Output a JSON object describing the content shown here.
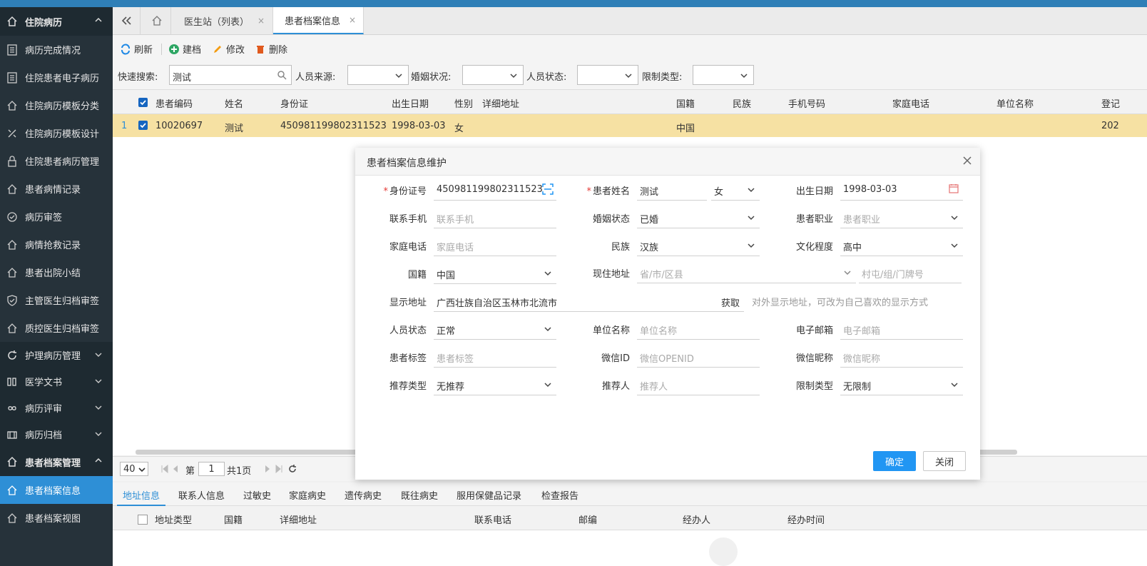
{
  "sidebar": {
    "group1": "住院病历",
    "items": [
      "病历完成情况",
      "住院患者电子病历",
      "住院病历模板分类",
      "住院病历模板设计",
      "住院患者病历管理",
      "患者病情记录",
      "病历审签",
      "病情抢救记录",
      "患者出院小结",
      "主管医生归档审签",
      "质控医生归档审签"
    ],
    "groups": [
      "护理病历管理",
      "医学文书",
      "病历评审",
      "病历归档"
    ],
    "group6": "患者档案管理",
    "sub_items": [
      "患者档案信息",
      "患者档案视图"
    ]
  },
  "tabs": {
    "tab1": "医生站（列表）",
    "tab2": "患者档案信息",
    "close": "×"
  },
  "toolbar": {
    "refresh": "刷新",
    "create": "建档",
    "edit": "修改",
    "delete": "删除"
  },
  "search": {
    "quick_label": "快速搜索:",
    "quick_value": "测试",
    "source_label": "人员来源:",
    "marital_label": "婚姻状况:",
    "status_label": "人员状态:",
    "limit_label": "限制类型:"
  },
  "grid": {
    "headers": [
      "患者编码",
      "姓名",
      "身份证",
      "出生日期",
      "性别",
      "详细地址",
      "国籍",
      "民族",
      "手机号码",
      "家庭电话",
      "单位名称",
      "登记"
    ],
    "row": {
      "index": "1",
      "code": "10020697",
      "name": "测试",
      "id_card": "450981199802311523",
      "birth": "1998-03-03",
      "gender": "女",
      "nationality": "中国",
      "reg": "202"
    }
  },
  "pager": {
    "page_size": "40",
    "page_prefix": "第",
    "page_value": "1",
    "page_total": "共1页"
  },
  "bottom_tabs": [
    "地址信息",
    "联系人信息",
    "过敏史",
    "家庭病史",
    "遗传病史",
    "既往病史",
    "服用保健品记录",
    "检查报告"
  ],
  "bottom_headers": [
    "地址类型",
    "国籍",
    "详细地址",
    "联系电话",
    "邮编",
    "经办人",
    "经办时间"
  ],
  "modal": {
    "title": "患者档案信息维护",
    "required_mark": "*",
    "id_card_label": "身份证号",
    "id_card_value": "450981199802311523",
    "name_label": "患者姓名",
    "name_value": "测试",
    "gender_value": "女",
    "birth_label": "出生日期",
    "birth_value": "1998-03-03",
    "phone_label": "联系手机",
    "phone_placeholder": "联系手机",
    "marital_label": "婚姻状态",
    "marital_value": "已婚",
    "job_label": "患者职业",
    "job_placeholder": "患者职业",
    "home_phone_label": "家庭电话",
    "home_phone_placeholder": "家庭电话",
    "ethnic_label": "民族",
    "ethnic_value": "汉族",
    "edu_label": "文化程度",
    "edu_value": "高中",
    "nationality_label": "国籍",
    "nationality_value": "中国",
    "address_label": "现住地址",
    "address_placeholder": "省/市/区县",
    "village_placeholder": "村屯/组/门牌号",
    "display_addr_label": "显示地址",
    "display_addr_value": "广西壮族自治区玉林市北流市",
    "fetch_label": "获取",
    "display_addr_hint": "对外显示地址，可改为自己喜欢的显示方式",
    "person_status_label": "人员状态",
    "person_status_value": "正常",
    "company_label": "单位名称",
    "company_placeholder": "单位名称",
    "email_label": "电子邮箱",
    "email_placeholder": "电子邮箱",
    "tag_label": "患者标签",
    "tag_placeholder": "患者标签",
    "wechat_label": "微信ID",
    "wechat_placeholder": "微信OPENID",
    "nick_label": "微信昵称",
    "nick_placeholder": "微信昵称",
    "rec_type_label": "推荐类型",
    "rec_type_value": "无推荐",
    "referrer_label": "推荐人",
    "referrer_placeholder": "推荐人",
    "limit_label": "限制类型",
    "limit_value": "无限制",
    "ok": "确定",
    "close": "关闭"
  },
  "colors": {
    "accent": "#2e8fd6",
    "sidebar_bg": "#26323a",
    "selected_row": "#f6e1a3",
    "required": "#e53935"
  }
}
